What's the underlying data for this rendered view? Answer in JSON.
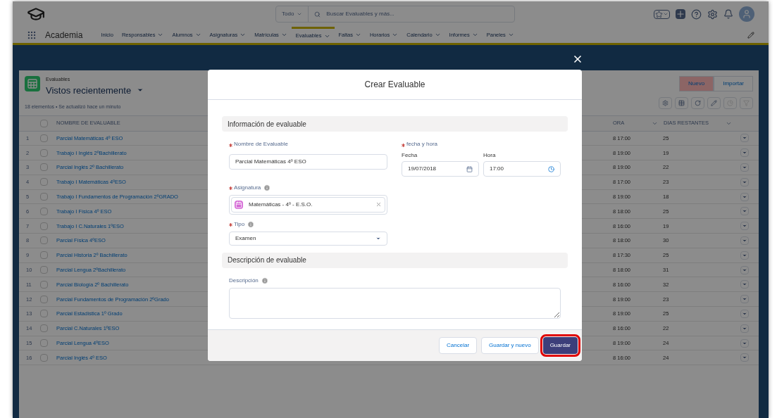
{
  "header": {
    "search_scope": "Todo",
    "search_placeholder": "Buscar Evaluables y más..."
  },
  "nav": {
    "app_name": "Academia",
    "items": [
      {
        "label": "Inicio",
        "has_menu": false,
        "selected": false
      },
      {
        "label": "Responsables",
        "has_menu": true,
        "selected": false
      },
      {
        "label": "Alumnos",
        "has_menu": true,
        "selected": false
      },
      {
        "label": "Asignaturas",
        "has_menu": true,
        "selected": false
      },
      {
        "label": "Matrículas",
        "has_menu": true,
        "selected": false
      },
      {
        "label": "Evaluables",
        "has_menu": true,
        "selected": true
      },
      {
        "label": "Faltas",
        "has_menu": true,
        "selected": false
      },
      {
        "label": "Horarios",
        "has_menu": true,
        "selected": false
      },
      {
        "label": "Calendario",
        "has_menu": true,
        "selected": false
      },
      {
        "label": "Informes",
        "has_menu": true,
        "selected": false
      },
      {
        "label": "Paneles",
        "has_menu": true,
        "selected": false
      }
    ]
  },
  "list": {
    "object": "Evaluables",
    "view": "Vistos recientemente",
    "status": "18 elementos • Se actualizó hace un minuto",
    "buttons": [
      {
        "label": "Nuevo",
        "highlighted": true
      },
      {
        "label": "Importar",
        "highlighted": false
      }
    ],
    "columns": [
      "NOMBRE DE EVALUABLE",
      "ORA",
      "DIAS RESTANTES"
    ],
    "select_all_checked": false,
    "rows": [
      {
        "index": "1",
        "name": "Parcial Matemáticas 4º ESO",
        "date": "8 17:00",
        "days": "25",
        "checked": false
      },
      {
        "index": "2",
        "name": "Trabajo I Inglés 2ºBachillerato",
        "date": "8 19:00",
        "days": "19",
        "checked": false
      },
      {
        "index": "3",
        "name": "Parcial Inglés 2º Bachillerato",
        "date": "8 19:00",
        "days": "22",
        "checked": false
      },
      {
        "index": "4",
        "name": "Trabajo I Matemáticas 4ºESO",
        "date": "8 17:00",
        "days": "23",
        "checked": false
      },
      {
        "index": "5",
        "name": "Trabajo I Fundamentos de Programación 2ºGRADO",
        "date": "8 19:00",
        "days": "18",
        "checked": false
      },
      {
        "index": "6",
        "name": "Trabajo I Física 4º ESO",
        "date": "8 18:00",
        "days": "25",
        "checked": false
      },
      {
        "index": "7",
        "name": "Trabajo I C.Naturales 1ºESO",
        "date": "8 16:00",
        "days": "19",
        "checked": false
      },
      {
        "index": "8",
        "name": "Parcial Física 4ºESO",
        "date": "8 18:00",
        "days": "30",
        "checked": false
      },
      {
        "index": "9",
        "name": "Parcial Historia 2º Bachillerato",
        "date": "8 17:30",
        "days": "25",
        "checked": false
      },
      {
        "index": "10",
        "name": "Parcial Lengua 2ºBachillerato",
        "date": "8 18:00",
        "days": "31",
        "checked": false
      },
      {
        "index": "11",
        "name": "Parcial Biología 2º Bachillerato",
        "date": "8 16:00",
        "days": "32",
        "checked": false
      },
      {
        "index": "12",
        "name": "Parcial Fundamentos de Programación 2ºGrado",
        "date": "8 19:00",
        "days": "23",
        "checked": false
      },
      {
        "index": "13",
        "name": "Parcial Estadística 1º Grado",
        "date": "8 19:00",
        "days": "25",
        "checked": false
      },
      {
        "index": "14",
        "name": "Parcial C.Naturales 1ºESO",
        "date": "8 16:00",
        "days": "22",
        "checked": false
      },
      {
        "index": "15",
        "name": "Parcial Lengua 4ºESO",
        "date": "8 19:00",
        "days": "24",
        "checked": false
      },
      {
        "index": "16",
        "name": "Parcial Inglés 4º ESO",
        "date": "8 16:00",
        "days": "24",
        "checked": false
      }
    ]
  },
  "modal": {
    "title": "Crear Evaluable",
    "section_info": "Información de evaluable",
    "name_field": {
      "label": "Nombre de Evaluable",
      "required": true,
      "value": "Parcial Matemáticas 4º ESO"
    },
    "datetime": {
      "label": "fecha y hora",
      "required": true,
      "date_label": "Fecha",
      "date_value": "19/07/2018",
      "time_label": "Hora",
      "time_value": "17:00"
    },
    "subject": {
      "label": "Asignatura",
      "required": true,
      "has_info": true,
      "value": "Matemáticas - 4º - E.S.O."
    },
    "type": {
      "label": "Tipo",
      "required": true,
      "has_info": true,
      "value": "Examen"
    },
    "section_desc": "Descripción de evaluable",
    "description": {
      "label": "Descripción",
      "required": false,
      "has_info": true
    },
    "buttons": [
      {
        "label": "Cancelar",
        "kind": "neutral",
        "highlighted": false
      },
      {
        "label": "Guardar y nuevo",
        "kind": "neutral",
        "highlighted": false
      },
      {
        "label": "Guardar",
        "kind": "brand",
        "highlighted": true
      }
    ]
  }
}
